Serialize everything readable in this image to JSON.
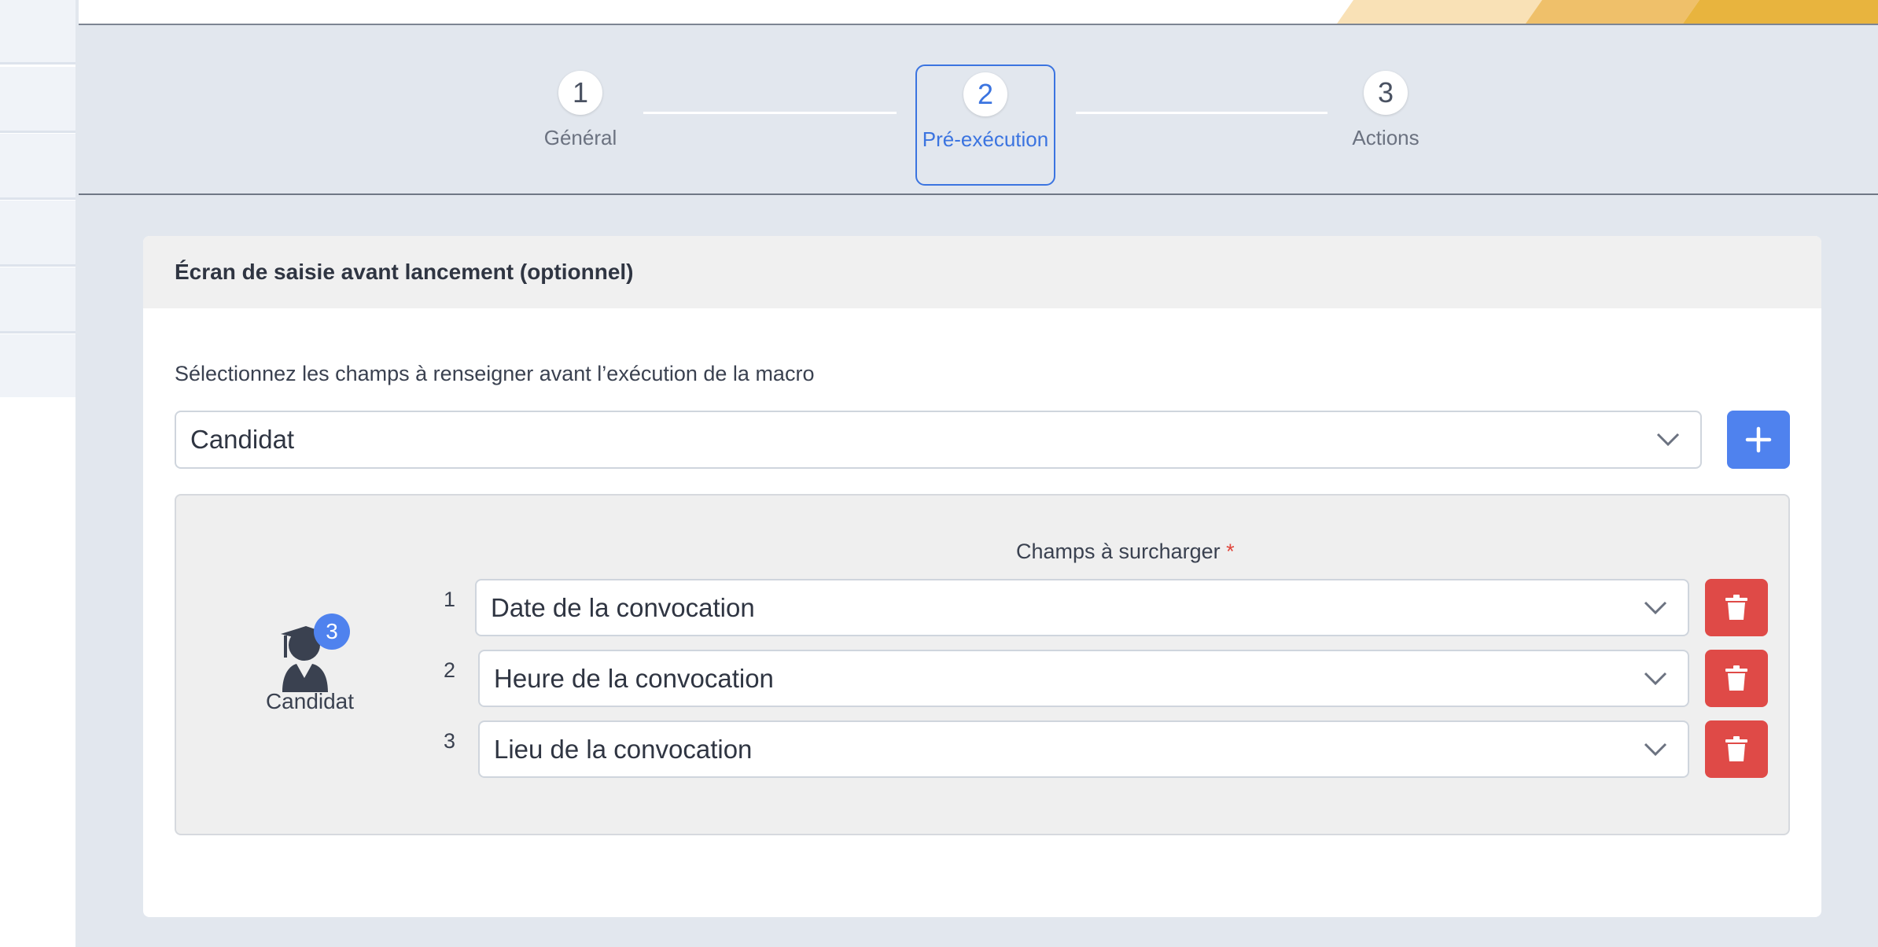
{
  "steps": [
    {
      "number": "1",
      "label": "Général",
      "active": false
    },
    {
      "number": "2",
      "label": "Pré-exécution",
      "active": true
    },
    {
      "number": "3",
      "label": "Actions",
      "active": false
    }
  ],
  "card": {
    "title": "Écran de saisie avant lancement (optionnel)",
    "instruction": "Sélectionnez les champs à renseigner avant l’exécution de la macro",
    "entity_select": {
      "value": "Candidat"
    },
    "add_button_icon": "plus-icon"
  },
  "entity": {
    "label": "Candidat",
    "badge_count": "3",
    "icon": "graduate-user-icon"
  },
  "fields": {
    "label": "Champs à surcharger",
    "required_marker": "*",
    "rows": [
      {
        "index": "1",
        "value": "Date de la convocation"
      },
      {
        "index": "2",
        "value": "Heure de la convocation"
      },
      {
        "index": "3",
        "value": "Lieu de la convocation"
      }
    ],
    "delete_icon": "trash-icon"
  },
  "colors": {
    "accent": "#4f82ee",
    "active_step": "#3b74e0",
    "danger": "#df4a47",
    "background": "#e2e7ee"
  }
}
